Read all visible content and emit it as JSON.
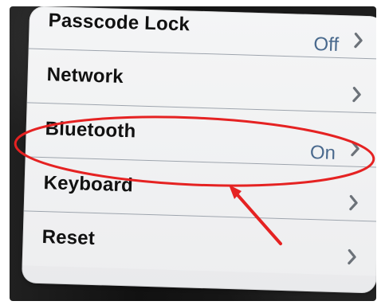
{
  "settings": {
    "rows": [
      {
        "label": "Passcode Lock",
        "value": "Off",
        "icon": "chevron-right-icon"
      },
      {
        "label": "Network",
        "value": "",
        "icon": "chevron-right-icon"
      },
      {
        "label": "Bluetooth",
        "value": "On",
        "icon": "chevron-right-icon"
      },
      {
        "label": "Keyboard",
        "value": "",
        "icon": "chevron-right-icon"
      },
      {
        "label": "Reset",
        "value": "",
        "icon": "chevron-right-icon"
      }
    ]
  },
  "annotation": {
    "highlight_color": "#e52222",
    "arrow_color": "#e52222",
    "ellipse_icon": "highlight-ellipse",
    "arrow_icon": "pointer-arrow"
  },
  "colors": {
    "panel": "#f2f3f4",
    "divider": "#9da4ad",
    "value_text": "#49698d",
    "label_text": "#111111",
    "chevron": "#6c7279"
  }
}
